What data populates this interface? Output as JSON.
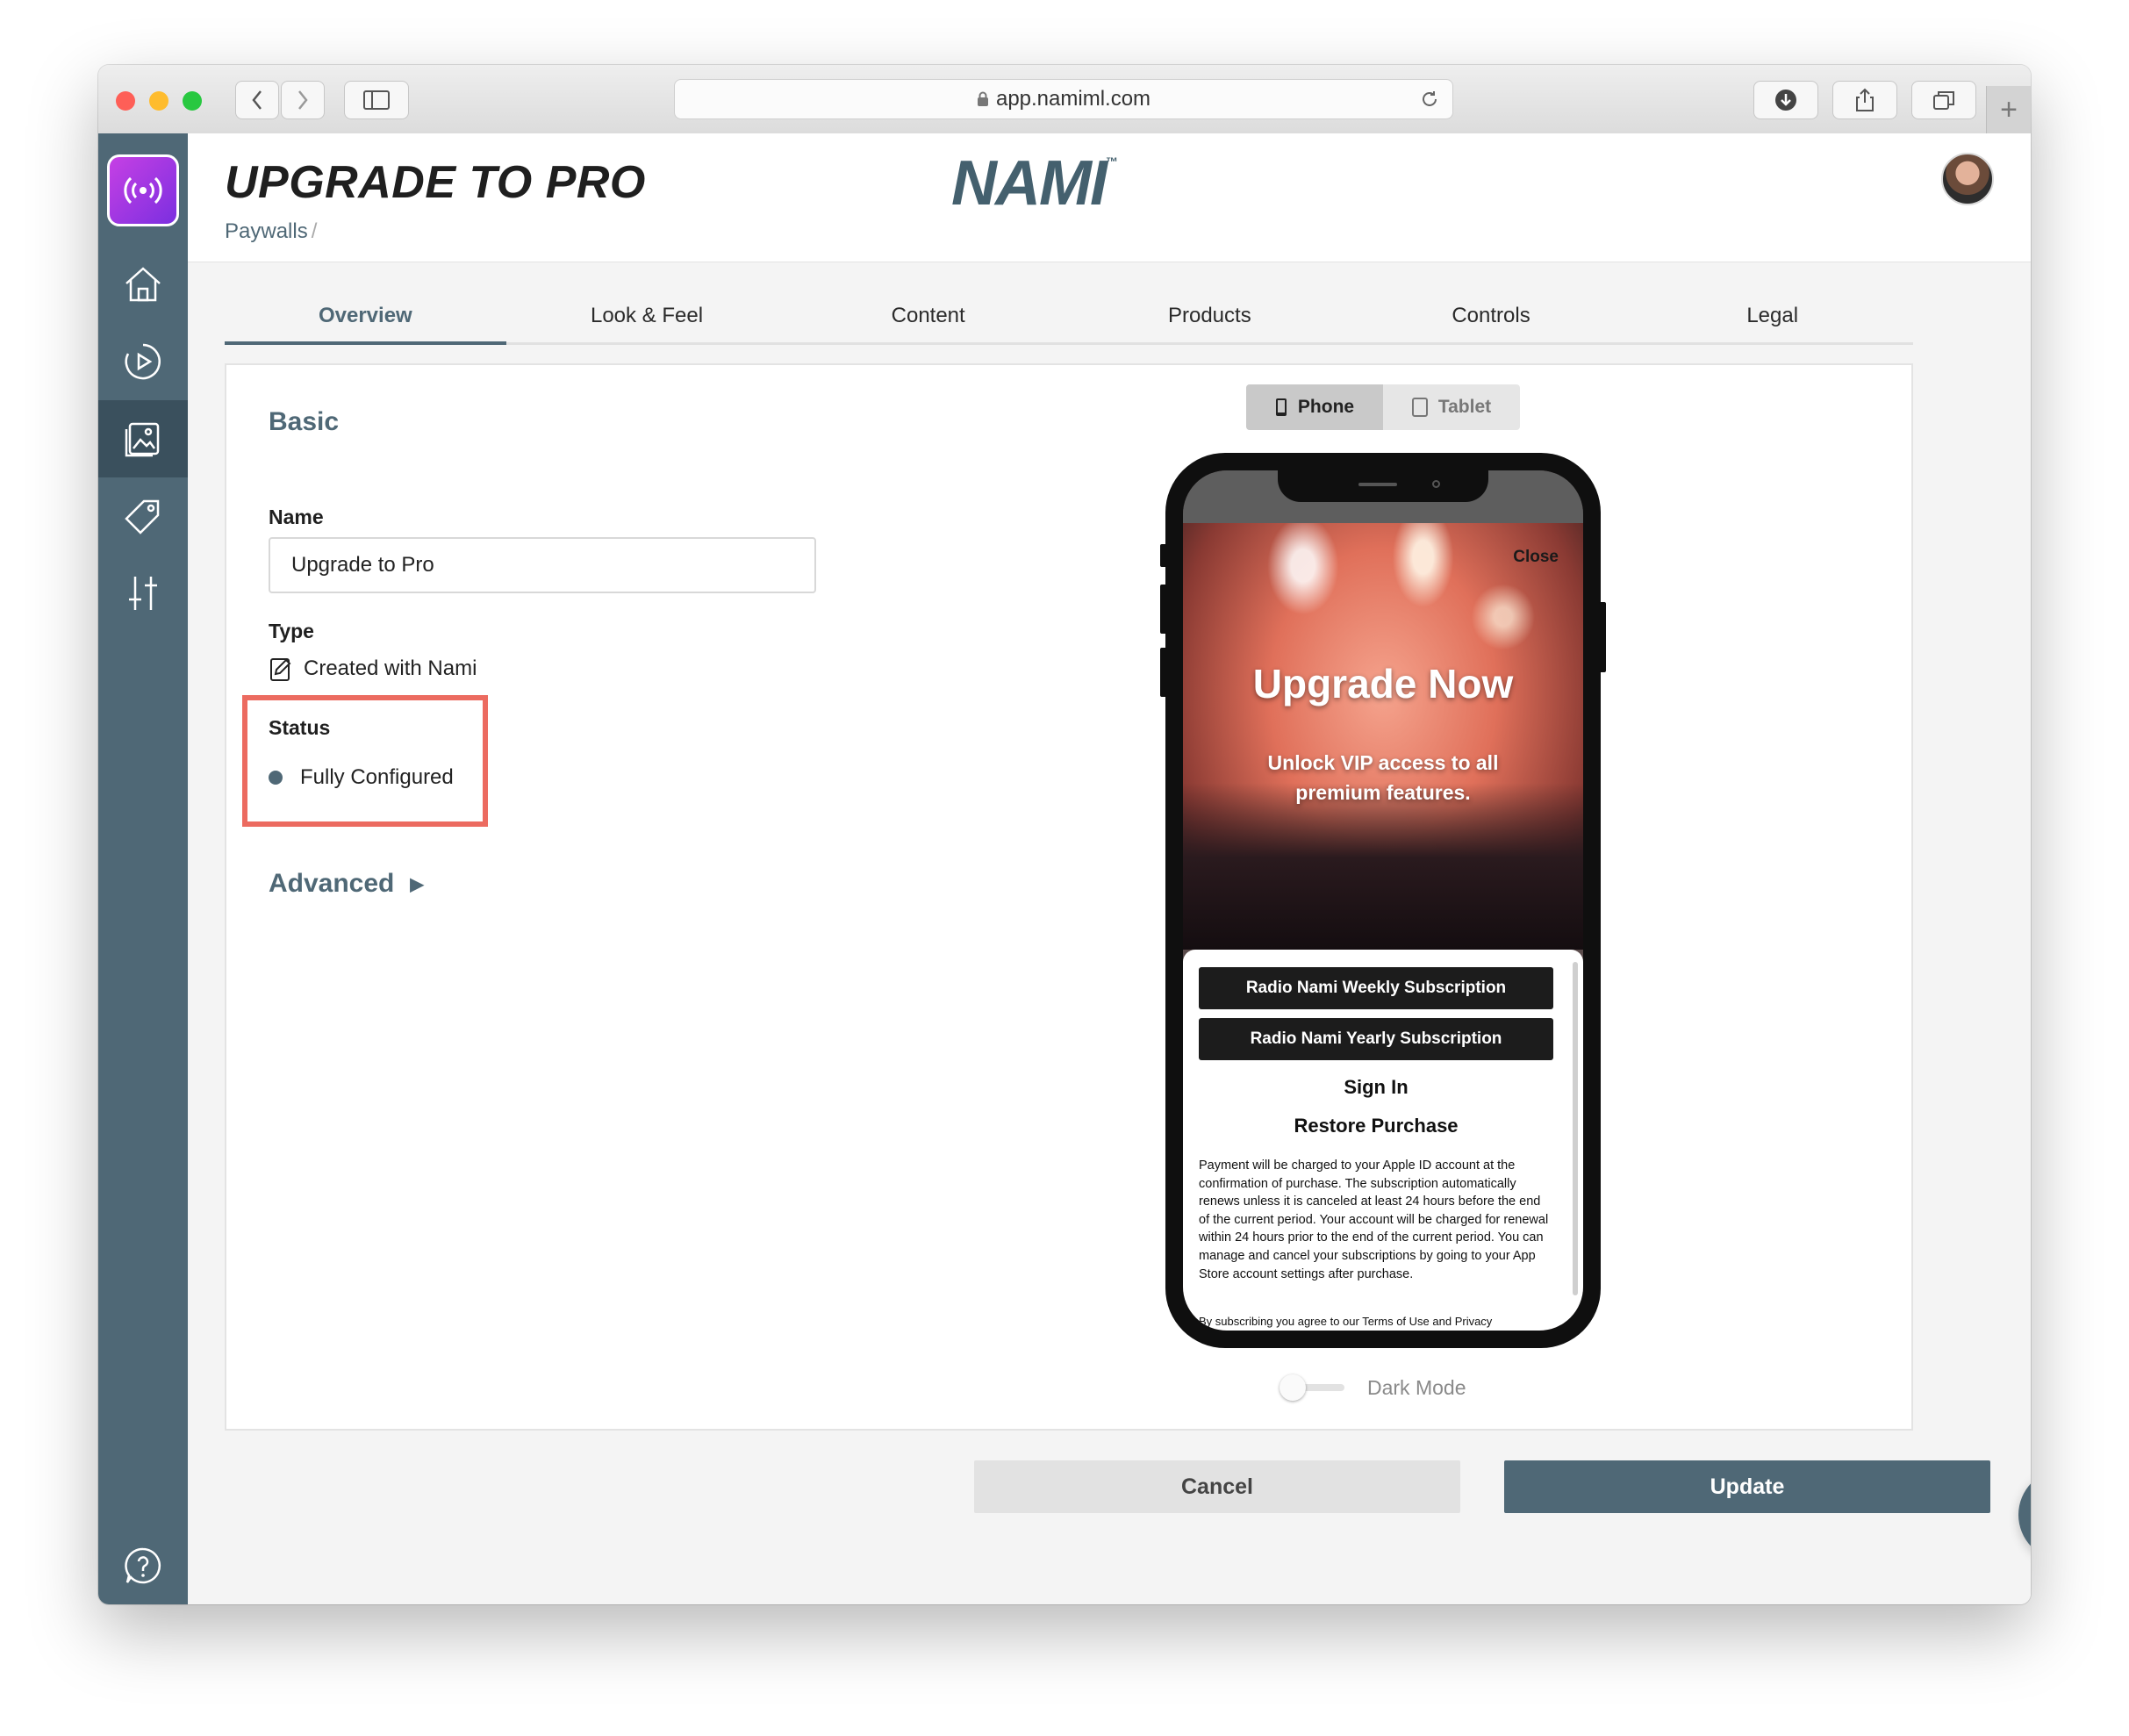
{
  "browser": {
    "url": "app.namiml.com"
  },
  "header": {
    "title": "UPGRADE TO PRO",
    "breadcrumb": "Paywalls",
    "breadcrumb_sep": "/",
    "brand": "NAMI",
    "brand_tm": "™"
  },
  "tabs": [
    {
      "label": "Overview",
      "active": true
    },
    {
      "label": "Look & Feel"
    },
    {
      "label": "Content"
    },
    {
      "label": "Products"
    },
    {
      "label": "Controls"
    },
    {
      "label": "Legal"
    }
  ],
  "basic": {
    "section_title": "Basic",
    "name_label": "Name",
    "name_value": "Upgrade to Pro",
    "type_label": "Type",
    "type_value": "Created with Nami",
    "status_label": "Status",
    "status_value": "Fully Configured",
    "advanced_label": "Advanced"
  },
  "preview": {
    "device_options": [
      "Phone",
      "Tablet"
    ],
    "selected_device": "Phone",
    "close_label": "Close",
    "headline": "Upgrade Now",
    "subhead": "Unlock VIP access to all premium features.",
    "products": [
      "Radio Nami Weekly Subscription",
      "Radio Nami Yearly Subscription"
    ],
    "sign_in": "Sign In",
    "restore": "Restore Purchase",
    "legal_text": "Payment will be charged to your Apple ID account at the confirmation of purchase. The subscription automatically renews unless it is canceled at least 24 hours before the end of the current period. Your account will be charged for renewal within 24 hours prior to the end of the current period. You can manage and cancel your subscriptions by going to your App Store account settings after purchase.",
    "legal_more": "By subscribing you agree to our Terms of Use and Privacy",
    "dark_mode_label": "Dark Mode"
  },
  "actions": {
    "cancel": "Cancel",
    "update": "Update"
  },
  "colors": {
    "accent": "#4f6876",
    "highlight": "#ec6b60"
  }
}
